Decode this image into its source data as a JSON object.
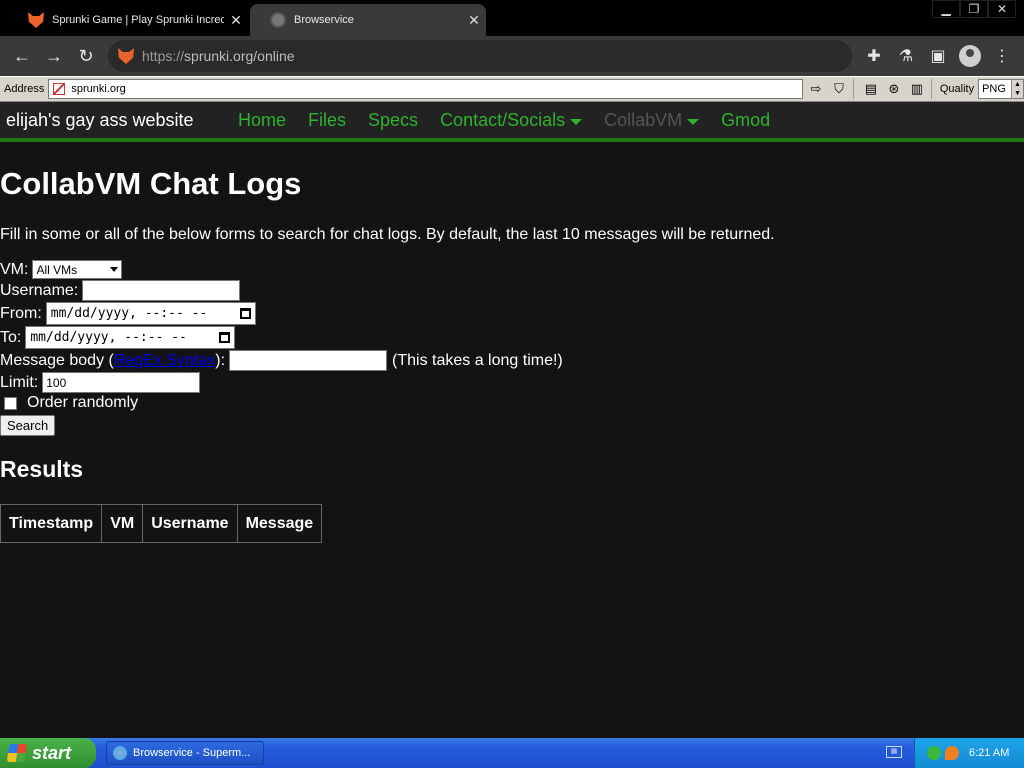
{
  "browser": {
    "tabs": [
      {
        "title": "Sprunki Game | Play Sprunki Incredibox Online",
        "active": true
      },
      {
        "title": "Browservice",
        "active": false
      }
    ],
    "url_scheme": "https://",
    "url_rest": "sprunki.org/online"
  },
  "browservice": {
    "address_label": "Address",
    "address_value": "sprunki.org",
    "quality_label": "Quality",
    "quality_value": "PNG"
  },
  "site_nav": {
    "brand": "elijah's gay ass website",
    "links": [
      "Home",
      "Files",
      "Specs",
      "Contact/Socials",
      "CollabVM",
      "Gmod"
    ]
  },
  "page": {
    "title": "CollabVM Chat Logs",
    "intro": "Fill in some or all of the below forms to search for chat logs. By default, the last 10 messages will be returned.",
    "vm_label": "VM:",
    "vm_value": "All VMs",
    "username_label": "Username:",
    "from_label": "From:",
    "to_label": "To:",
    "datetime_placeholder": "mm/dd/yyyy, --:-- --",
    "message_label_pre": "Message body (",
    "message_link": "RegEx Syntax",
    "message_label_post": "):",
    "message_hint": "(This takes a long time!)",
    "limit_label": "Limit:",
    "limit_value": "100",
    "order_label": "Order randomly",
    "search_button": "Search",
    "results_heading": "Results",
    "columns": [
      "Timestamp",
      "VM",
      "Username",
      "Message"
    ]
  },
  "taskbar": {
    "start": "start",
    "window": "Browservice - Superm...",
    "time": "6:21 AM"
  },
  "colors": {
    "nav_link": "#2fb22f",
    "nav_border": "#1e7a10",
    "page_bg": "#131313"
  }
}
